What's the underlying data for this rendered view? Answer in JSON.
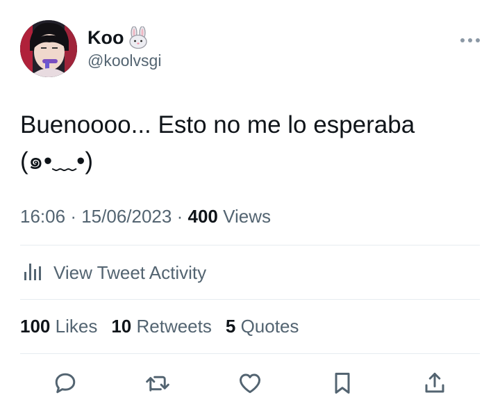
{
  "author": {
    "display_name": "Koo",
    "emoji": "rabbit-face",
    "handle": "@koolvsgi"
  },
  "tweet": {
    "text": "Buenoooo... Esto no me lo esperaba\n(๑•﹏•)"
  },
  "meta": {
    "time": "16:06",
    "separator": "·",
    "date": "15/06/2023",
    "views_count": "400",
    "views_label": "Views"
  },
  "activity": {
    "label": "View Tweet Activity"
  },
  "stats": [
    {
      "count": "100",
      "label": "Likes"
    },
    {
      "count": "10",
      "label": "Retweets"
    },
    {
      "count": "5",
      "label": "Quotes"
    }
  ],
  "actions": [
    "reply-icon",
    "retweet-icon",
    "like-icon",
    "bookmark-icon",
    "share-icon"
  ],
  "colors": {
    "text_primary": "#0f1419",
    "text_secondary": "#536471",
    "divider": "#e6ecf0",
    "icon": "#536471"
  }
}
